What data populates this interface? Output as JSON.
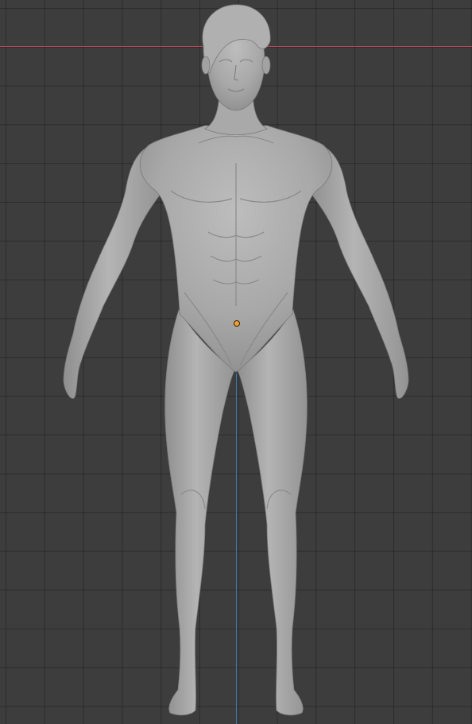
{
  "viewport": {
    "view": "front",
    "grid": true,
    "object": "male-body-sculpt",
    "colors": {
      "background": "#3d3d3d",
      "grid_line": "#353535",
      "x_axis": "#b54656",
      "z_axis": "#3f78b5",
      "mesh": "#a6a6a6",
      "origin_point": "#f0a030"
    }
  }
}
